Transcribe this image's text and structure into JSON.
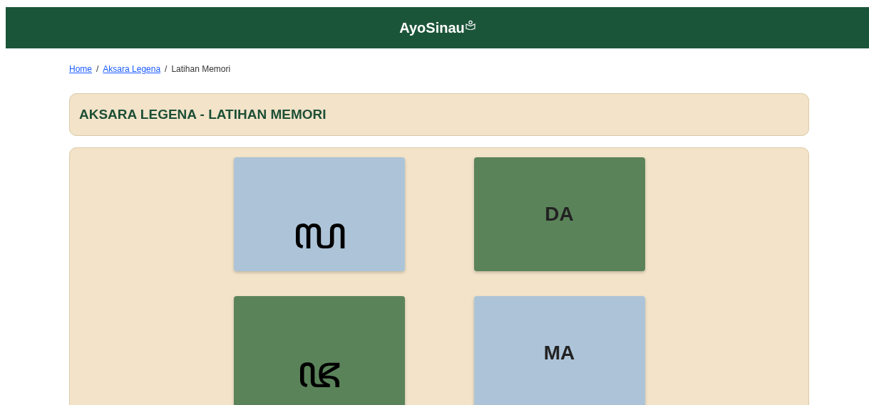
{
  "header": {
    "logo": "AyoSinau"
  },
  "breadcrumb_separator": "/",
  "breadcrumb": [
    {
      "label": "Home",
      "kind": "link"
    },
    {
      "label": "Aksara Legena",
      "kind": "link"
    },
    {
      "label": "Latihan Memori",
      "kind": "current"
    }
  ],
  "title": "AKSARA LEGENA - LATIHAN MEMORI",
  "cards": [
    {
      "text": "ꦭ",
      "kind": "aksara",
      "color": "#adc4d8"
    },
    {
      "text": "DA",
      "kind": "latin",
      "color": "#5b835a"
    },
    {
      "text": "ꦗ",
      "kind": "aksara",
      "color": "#5b835a"
    },
    {
      "text": "MA",
      "kind": "latin",
      "color": "#adc4d8"
    }
  ]
}
